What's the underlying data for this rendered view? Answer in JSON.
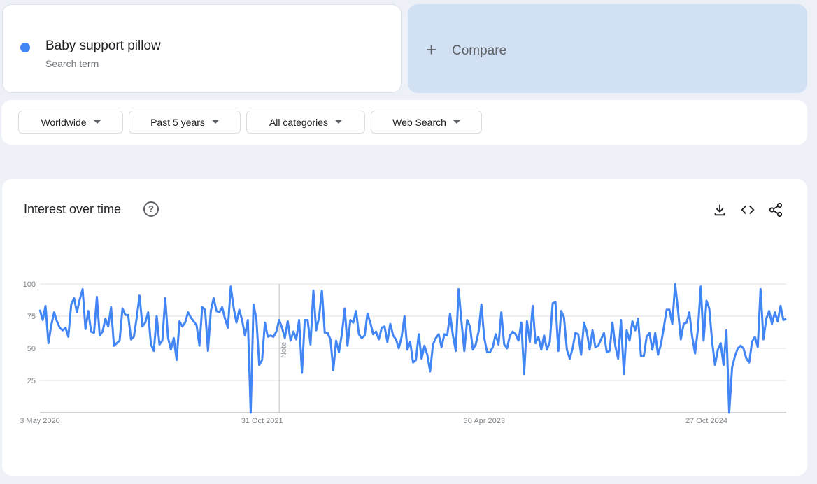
{
  "search_term": {
    "name": "Baby support pillow",
    "type_label": "Search term",
    "color": "#4285f4"
  },
  "compare": {
    "label": "Compare"
  },
  "filters": [
    {
      "label": "Worldwide"
    },
    {
      "label": "Past 5 years"
    },
    {
      "label": "All categories"
    },
    {
      "label": "Web Search"
    }
  ],
  "chart_section": {
    "title": "Interest over time",
    "icons": [
      "help-icon",
      "download-icon",
      "embed-code-icon",
      "share-icon"
    ],
    "note_label": "Note"
  },
  "chart_data": {
    "type": "line",
    "xlabel": "",
    "ylabel": "",
    "ylim": [
      0,
      100
    ],
    "y_ticks": [
      25,
      50,
      75,
      100
    ],
    "x_tick_labels": [
      "3 May 2020",
      "31 Oct 2021",
      "30 Apr 2023",
      "27 Oct 2024"
    ],
    "x_range": [
      "3 May 2020",
      "27 Apr 2025"
    ],
    "series": [
      {
        "color": "#4285f4",
        "values": [
          80,
          72,
          83,
          54,
          68,
          78,
          71,
          66,
          64,
          66,
          59,
          84,
          89,
          78,
          88,
          96,
          65,
          79,
          63,
          62,
          90,
          60,
          63,
          73,
          67,
          82,
          52,
          54,
          56,
          81,
          76,
          76,
          57,
          59,
          74,
          91,
          67,
          70,
          78,
          53,
          48,
          75,
          53,
          56,
          89,
          58,
          49,
          58,
          41,
          71,
          67,
          70,
          78,
          74,
          71,
          68,
          52,
          82,
          80,
          48,
          79,
          89,
          79,
          78,
          82,
          73,
          66,
          98,
          82,
          70,
          80,
          72,
          60,
          72,
          0,
          84,
          73,
          37,
          41,
          70,
          59,
          60,
          59,
          63,
          72,
          66,
          58,
          71,
          56,
          63,
          57,
          72,
          31,
          72,
          72,
          53,
          95,
          64,
          74,
          95,
          62,
          62,
          57,
          33,
          56,
          47,
          61,
          81,
          52,
          72,
          70,
          79,
          61,
          58,
          60,
          77,
          70,
          61,
          63,
          57,
          66,
          67,
          55,
          69,
          60,
          57,
          50,
          59,
          75,
          49,
          55,
          39,
          41,
          61,
          42,
          52,
          45,
          32,
          53,
          58,
          61,
          51,
          61,
          60,
          77,
          60,
          48,
          96,
          71,
          48,
          72,
          67,
          49,
          53,
          63,
          84,
          58,
          47,
          47,
          51,
          61,
          53,
          78,
          53,
          50,
          60,
          63,
          61,
          56,
          70,
          30,
          71,
          55,
          83,
          54,
          59,
          49,
          60,
          49,
          55,
          85,
          86,
          48,
          79,
          74,
          49,
          42,
          50,
          62,
          61,
          45,
          70,
          63,
          49,
          64,
          51,
          52,
          57,
          62,
          47,
          48,
          70,
          52,
          42,
          72,
          30,
          64,
          56,
          71,
          64,
          73,
          44,
          44,
          59,
          62,
          49,
          62,
          45,
          53,
          66,
          80,
          80,
          69,
          100,
          80,
          57,
          69,
          70,
          78,
          59,
          46,
          65,
          98,
          56,
          87,
          81,
          55,
          37,
          49,
          54,
          37,
          64,
          0,
          35,
          44,
          50,
          52,
          50,
          42,
          39,
          55,
          59,
          51,
          96,
          57,
          73,
          79,
          69,
          78,
          71,
          83,
          72,
          73
        ]
      }
    ]
  }
}
